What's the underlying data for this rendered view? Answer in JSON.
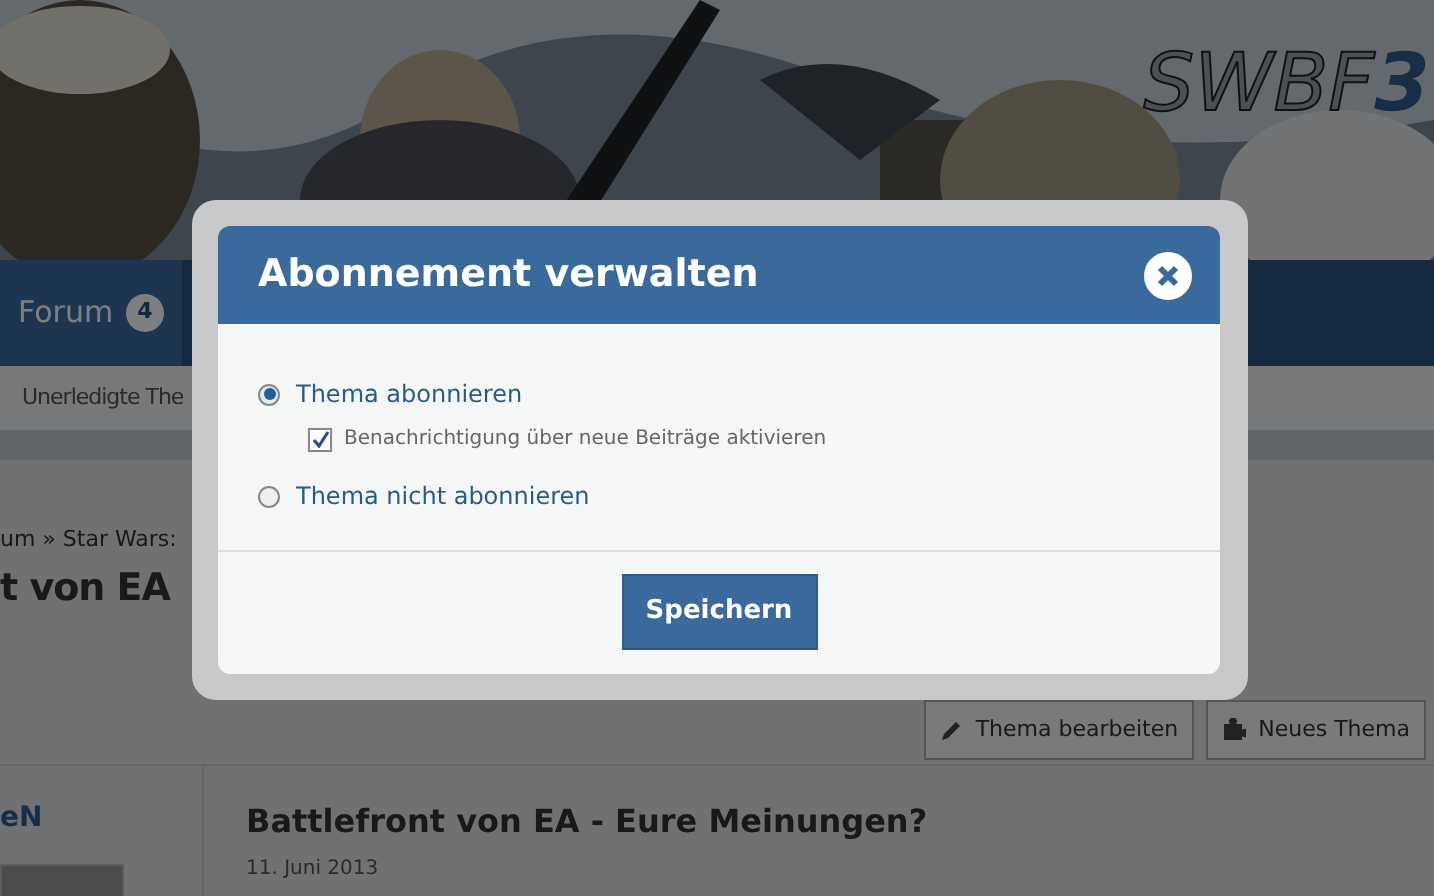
{
  "header": {
    "logo": "SWBF",
    "logo_accent": "3",
    "kind": "picture"
  },
  "nav": {
    "tabs": [
      {
        "label": "Forum",
        "badge": "4",
        "selected": true
      }
    ]
  },
  "subnav": {
    "items": [
      "Unerledigte The"
    ]
  },
  "breadcrumb": "um » Star Wars:",
  "page_title": "t von EA",
  "actions": [
    {
      "kind": "edit",
      "label": "Thema bearbeiten"
    },
    {
      "kind": "new",
      "label": "Neues Thema"
    }
  ],
  "sidebar": {
    "user": "eN"
  },
  "post": {
    "title": "Battlefront von EA - Eure Meinungen?",
    "date": "11. Juni 2013"
  },
  "dialog": {
    "title": "Abonnement verwalten",
    "options": [
      {
        "kind": "radio",
        "label": "Thema abonnieren",
        "selected": true
      },
      {
        "kind": "checkbox",
        "label": "Benachrichtigung über neue Beiträge aktivieren",
        "checked": true
      },
      {
        "kind": "radio",
        "label": "Thema nicht abonnieren",
        "selected": false
      }
    ],
    "button": "Speichern"
  }
}
